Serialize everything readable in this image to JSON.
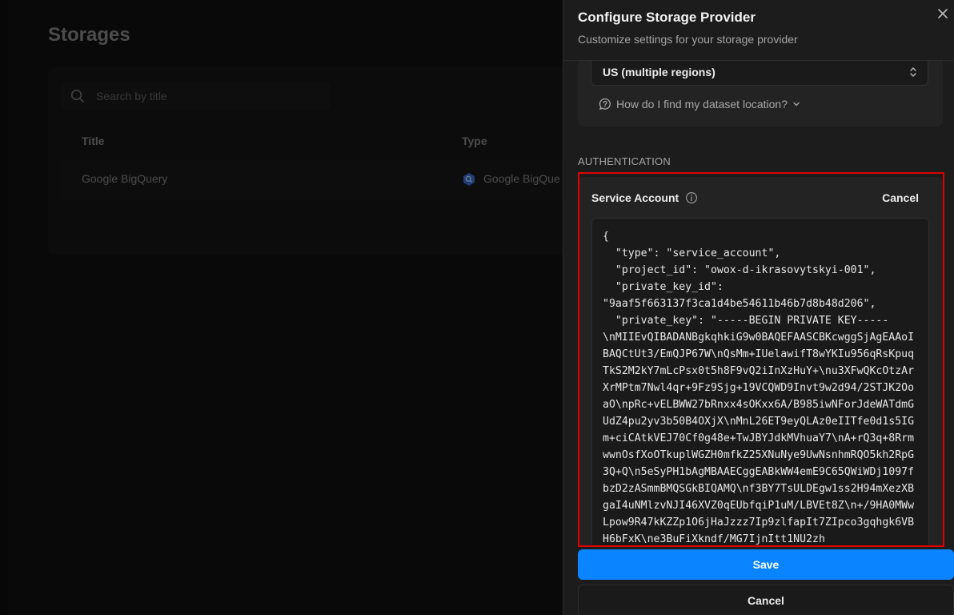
{
  "background": {
    "page_title": "Storages",
    "search": {
      "placeholder": "Search by title",
      "value": ""
    },
    "table": {
      "columns": [
        "Title",
        "Type"
      ],
      "rows": [
        {
          "title": "Google BigQuery",
          "type": "Google BigQue"
        }
      ]
    }
  },
  "drawer": {
    "title": "Configure Storage Provider",
    "subtitle": "Customize settings for your storage provider",
    "location": {
      "selected": "US (multiple regions)",
      "help_link": "How do I find my dataset location?"
    },
    "authentication": {
      "section_label": "AUTHENTICATION",
      "service_account_label": "Service Account",
      "cancel_label": "Cancel",
      "json_value": "{\n  \"type\": \"service_account\",\n  \"project_id\": \"owox-d-ikrasovytskyi-001\",\n  \"private_key_id\":\n\"9aaf5f663137f3ca1d4be54611b46b7d8b48d206\",\n  \"private_key\": \"-----BEGIN PRIVATE KEY-----\n\\nMIIEvQIBADANBgkqhkiG9w0BAQEFAASCBKcwggSjAgEAAoIBAQCtUt3/EmQJP67W\\nQsMm+IUelawifT8wYKIu956qRsKpuqTkS2M2kY7mLcPsx0t5h8F9vQ2iInXzHuY+\\nu3XFwQKcOtzArXrMPtm7Nwl4qr+9Fz9Sjg+19VCQWD9Invt9w2d94/2STJK2OoaO\\npRc+vELBWW27bRnxx4sOKxx6A/B985iwNForJdeWATdmGUdZ4pu2yv3b50B4OXjX\\nMnL26ET9eyQLAz0eIITfe0d1s5IGm+ciCAtkVEJ70Cf0g48e+TwJBYJdkMVhuaY7\\nA+rQ3q+8RrmwwnOsfXoOTkuplWGZH0mfkZ25XNuNye9UwNsnhmRQO5kh2RpG3Q+Q\\n5eSyPH1bAgMBAAECggEABkWW4emE9C65QWiWDj1097fbzD2zASmmBMQSGkBIQAMQ\\nf3BY7TsULDEgw1ss2H94mXezXBgaI4uNMlzvNJI46XVZ0qEUbfqiP1uM/LBVEt8Z\\n+/9HA0MWwLpow9R47kKZZp1O6jHaJzzz7Ip9zlfapIt7ZIpco3gqhgk6VBH6bFxK\\ne3BuFiXkndf/MG7IjnItt1NU2zh"
    },
    "buttons": {
      "save": "Save",
      "cancel": "Cancel"
    }
  }
}
